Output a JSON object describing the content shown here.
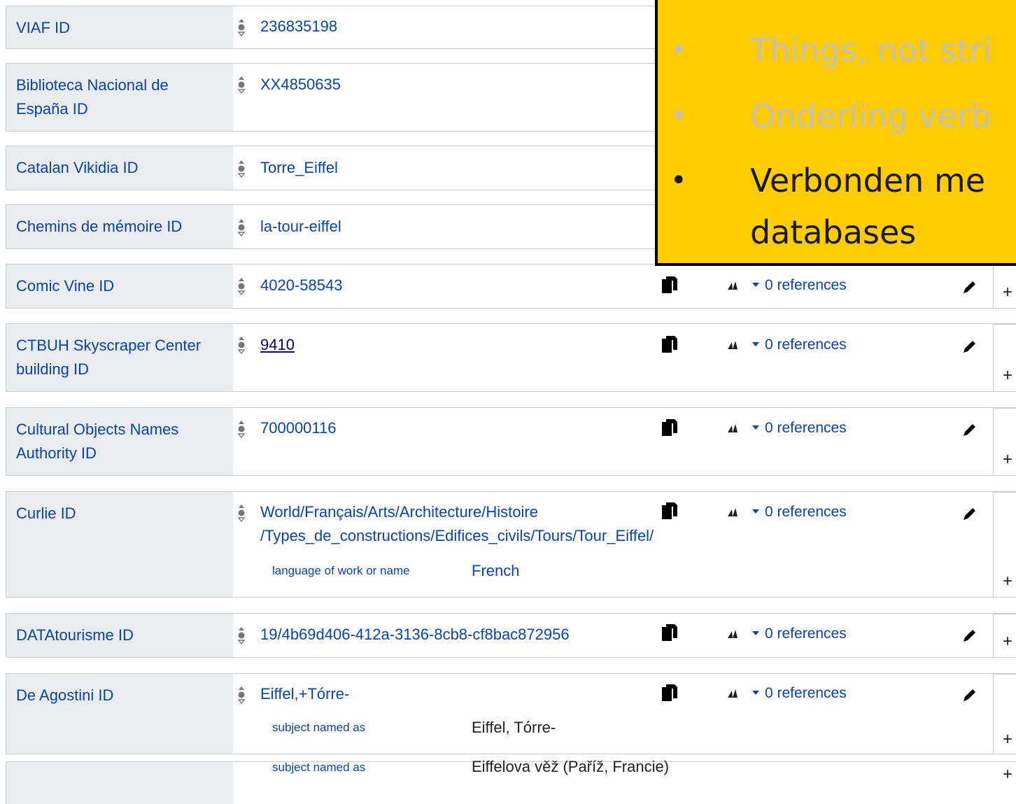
{
  "statements": [
    {
      "property": "VIAF ID",
      "value": "236835198"
    },
    {
      "property": "Biblioteca Nacional de España ID",
      "value": "XX4850635"
    },
    {
      "property": "Catalan Vikidia ID",
      "value": "Torre_Eiffel"
    },
    {
      "property": "Chemins de mémoire ID",
      "value": "la-tour-eiffel"
    },
    {
      "property": "Comic Vine ID",
      "value": "4020-58543",
      "references": "0 references"
    },
    {
      "property": "CTBUH Skyscraper Center building ID",
      "value": "9410",
      "references": "0 references"
    },
    {
      "property": "Cultural Objects Names Authority ID",
      "value": "700000116",
      "references": "0 references"
    },
    {
      "property": "Curlie ID",
      "value_line1": "World/Français/Arts/Architecture/Histoire",
      "value_line2": "/Types_de_constructions/Edifices_civils/Tours/Tour_Eiffel/",
      "references": "0 references",
      "qualifier": {
        "property": "language of work or name",
        "value": "French"
      }
    },
    {
      "property": "DATAtourisme ID",
      "value": "19/4b69d406-412a-3136-8cb8-cf8bac872956",
      "references": "0 references"
    },
    {
      "property": "De Agostini ID",
      "value": "Eiffel,+Tórre-",
      "references": "0 references",
      "qualifier": {
        "property": "subject named as",
        "value": "Eiffel, Tórre-"
      }
    },
    {
      "property": "",
      "qualifier": {
        "property": "subject named as",
        "value": "Eiffelova věž (Paříž, Francie)"
      }
    }
  ],
  "overlay": {
    "bullets": [
      {
        "text": "Things, not stri",
        "state": "dimmed"
      },
      {
        "text": "Onderling verb",
        "state": "dimmed"
      },
      {
        "text": "Verbonden me",
        "state": "active"
      },
      {
        "text": "databases",
        "state": "continuation"
      }
    ],
    "bullet_char": "•",
    "background": "#ffcc00"
  },
  "icons": {
    "plus": "+"
  },
  "colors": {
    "link": "#0645ad",
    "visited": "#0b0080",
    "property_bg": "#eaecf0",
    "border": "#c8ccd1"
  }
}
